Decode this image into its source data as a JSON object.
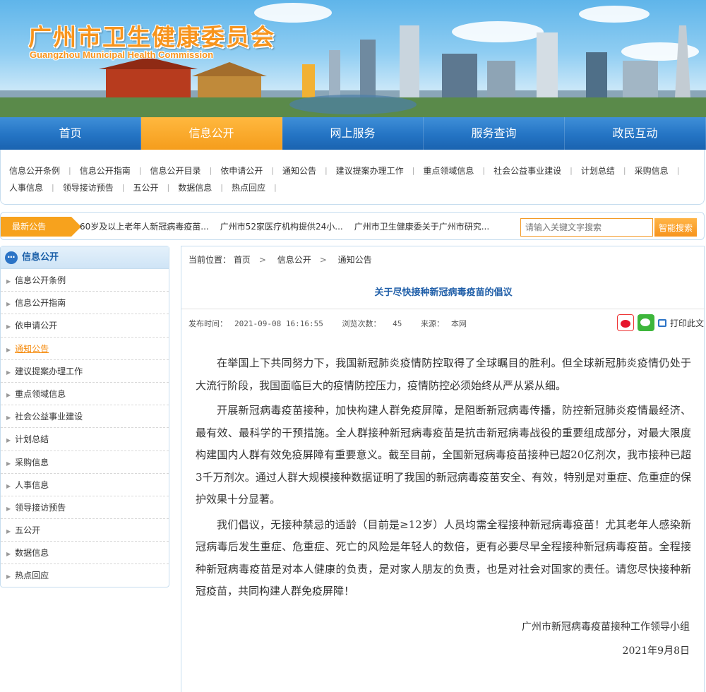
{
  "header": {
    "title_cn": "广州市卫生健康委员会",
    "title_en": "Guangzhou Municipal Health Commission"
  },
  "nav": [
    {
      "label": "首页"
    },
    {
      "label": "信息公开",
      "active": true
    },
    {
      "label": "网上服务"
    },
    {
      "label": "服务查询"
    },
    {
      "label": "政民互动"
    }
  ],
  "sublinks": {
    "row1": [
      "信息公开条例",
      "信息公开指南",
      "信息公开目录",
      "依申请公开",
      "通知公告",
      "建议提案办理工作",
      "重点领域信息",
      "社会公益事业建设",
      "计划总结",
      "采购信息"
    ],
    "row2": [
      "人事信息",
      "领导接访预告",
      "五公开",
      "数据信息",
      "热点回应"
    ]
  },
  "notice": {
    "tag": "最新公告",
    "items": [
      "60岁及以上老年人新冠病毒疫苗...",
      "广州市52家医疗机构提供24小...",
      "广州市卫生健康委关于广州市研究..."
    ]
  },
  "search": {
    "placeholder": "请输入关键文字搜索",
    "button": "智能搜索"
  },
  "sidebar": {
    "title": "信息公开",
    "items": [
      "信息公开条例",
      "信息公开指南",
      "依申请公开",
      "通知公告",
      "建议提案办理工作",
      "重点领域信息",
      "社会公益事业建设",
      "计划总结",
      "采购信息",
      "人事信息",
      "领导接访预告",
      "五公开",
      "数据信息",
      "热点回应"
    ],
    "current": "通知公告"
  },
  "breadcrumb": {
    "prefix": "当前位置：",
    "items": [
      "首页",
      "信息公开",
      "通知公告"
    ]
  },
  "article": {
    "title": "关于尽快接种新冠病毒疫苗的倡议",
    "publish_label": "发布时间：",
    "publish_time": "2021-09-08 16:16:55",
    "views_label": "浏览次数：",
    "views": "45",
    "source_label": "来源：",
    "source": "本网",
    "print": "打印此文",
    "paragraphs": [
      "在举国上下共同努力下，我国新冠肺炎疫情防控取得了全球瞩目的胜利。但全球新冠肺炎疫情仍处于大流行阶段，我国面临巨大的疫情防控压力，疫情防控必须始终从严从紧从细。",
      "开展新冠病毒疫苗接种，加快构建人群免疫屏障，是阻断新冠病毒传播，防控新冠肺炎疫情最经济、最有效、最科学的干预措施。全人群接种新冠病毒疫苗是抗击新冠病毒战役的重要组成部分，对最大限度构建国内人群有效免疫屏障有重要意义。截至目前，全国新冠病毒疫苗接种已超20亿剂次，我市接种已超3千万剂次。通过人群大规模接种数据证明了我国的新冠病毒疫苗安全、有效，特别是对重症、危重症的保护效果十分显著。",
      "我们倡议，无接种禁忌的适龄（目前是≥12岁）人员均需全程接种新冠病毒疫苗！尤其老年人感染新冠病毒后发生重症、危重症、死亡的风险是年轻人的数倍，更有必要尽早全程接种新冠病毒疫苗。全程接种新冠病毒疫苗是对本人健康的负责，是对家人朋友的负责，也是对社会对国家的责任。请您尽快接种新冠疫苗，共同构建人群免疫屏障！"
    ],
    "signature": "广州市新冠病毒疫苗接种工作领导小组",
    "date": "2021年9月8日"
  },
  "colors": {
    "nav_blue": "#2474c4",
    "accent_orange": "#f7941d",
    "title_blue": "#1f5ea8"
  }
}
